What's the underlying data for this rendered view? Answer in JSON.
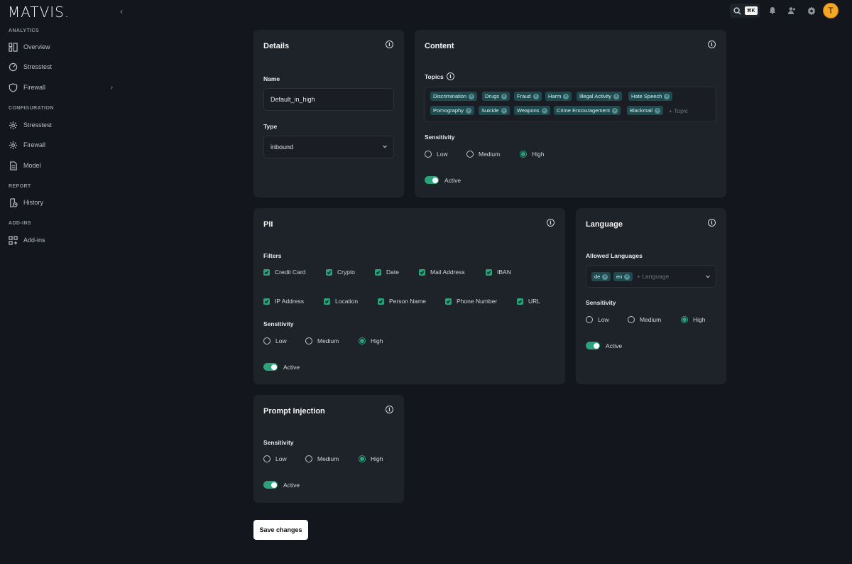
{
  "brand": {
    "logo": "MATVIS."
  },
  "sidebar": {
    "sections": [
      {
        "label": "ANALYTICS"
      },
      {
        "label": "CONFIGURATION"
      },
      {
        "label": "REPORT"
      },
      {
        "label": "ADD-INS"
      }
    ],
    "items": [
      {
        "label": "Overview",
        "icon": "dashboard-icon"
      },
      {
        "label": "Stresstest",
        "icon": "gauge-icon"
      },
      {
        "label": "Firewall",
        "icon": "shield-icon"
      },
      {
        "label": "Stresstest",
        "icon": "gear-icon"
      },
      {
        "label": "Firewall",
        "icon": "gear-icon"
      },
      {
        "label": "Model",
        "icon": "document-icon"
      },
      {
        "label": "History",
        "icon": "history-icon"
      },
      {
        "label": "Add-ins",
        "icon": "grid-plus-icon"
      }
    ]
  },
  "topbar": {
    "shortcut": "⌘K",
    "avatar_initial": "T"
  },
  "details": {
    "title": "Details",
    "name_label": "Name",
    "name_value": "Default_in_high",
    "type_label": "Type",
    "type_value": "inbound"
  },
  "content": {
    "title": "Content",
    "topics_label": "Topics",
    "topics": [
      "Discrimination",
      "Drugs",
      "Fraud",
      "Harm",
      "Illegal Activity",
      "Hate Speech",
      "Pornography",
      "Suicide",
      "Weapons",
      "Crime Encouragement",
      "Blackmail"
    ],
    "topic_placeholder": "+ Topic",
    "sensitivity_label": "Sensitivity",
    "sensitivity": {
      "low": "Low",
      "medium": "Medium",
      "high": "High",
      "selected": "High"
    },
    "active_label": "Active"
  },
  "pii": {
    "title": "PII",
    "filters_label": "Filters",
    "filters": [
      "Credit Card",
      "Crypto",
      "Date",
      "Mail Address",
      "IBAN",
      "IP Address",
      "Location",
      "Person Name",
      "Phone Number",
      "URL"
    ],
    "sensitivity_label": "Sensitivity",
    "sensitivity": {
      "low": "Low",
      "medium": "Medium",
      "high": "High",
      "selected": "High"
    },
    "active_label": "Active"
  },
  "language": {
    "title": "Language",
    "allowed_label": "Allowed Languages",
    "languages": [
      "de",
      "en"
    ],
    "language_placeholder": "+ Language",
    "sensitivity_label": "Sensitivity",
    "sensitivity": {
      "low": "Low",
      "medium": "Medium",
      "high": "High",
      "selected": "High"
    },
    "active_label": "Active"
  },
  "prompt_injection": {
    "title": "Prompt Injection",
    "sensitivity_label": "Sensitivity",
    "sensitivity": {
      "low": "Low",
      "medium": "Medium",
      "high": "High",
      "selected": "High"
    },
    "active_label": "Active"
  },
  "actions": {
    "save_label": "Save changes"
  },
  "colors": {
    "accent": "#2aa37a",
    "tag_bg": "#1d4b50",
    "card_bg": "#1e2229",
    "page_bg": "#13161d",
    "avatar": "#f5a623"
  }
}
